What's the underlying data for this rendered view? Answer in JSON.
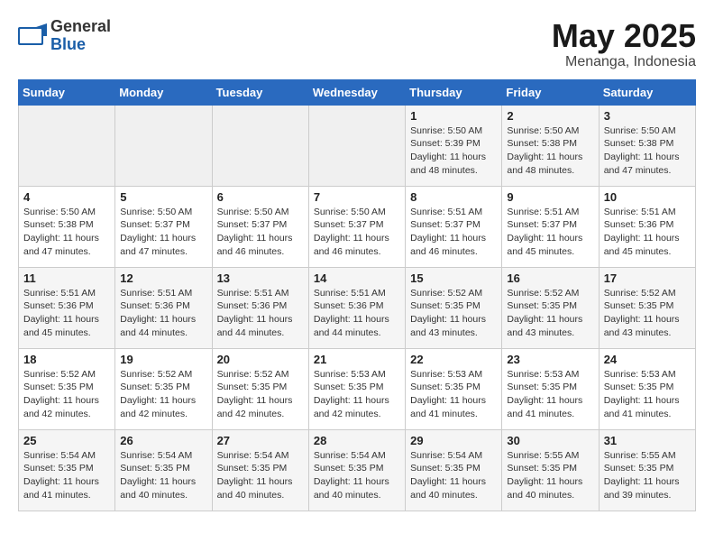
{
  "header": {
    "logo_general": "General",
    "logo_blue": "Blue",
    "month": "May 2025",
    "location": "Menanga, Indonesia"
  },
  "weekdays": [
    "Sunday",
    "Monday",
    "Tuesday",
    "Wednesday",
    "Thursday",
    "Friday",
    "Saturday"
  ],
  "weeks": [
    [
      {
        "day": "",
        "info": ""
      },
      {
        "day": "",
        "info": ""
      },
      {
        "day": "",
        "info": ""
      },
      {
        "day": "",
        "info": ""
      },
      {
        "day": "1",
        "info": "Sunrise: 5:50 AM\nSunset: 5:39 PM\nDaylight: 11 hours\nand 48 minutes."
      },
      {
        "day": "2",
        "info": "Sunrise: 5:50 AM\nSunset: 5:38 PM\nDaylight: 11 hours\nand 48 minutes."
      },
      {
        "day": "3",
        "info": "Sunrise: 5:50 AM\nSunset: 5:38 PM\nDaylight: 11 hours\nand 47 minutes."
      }
    ],
    [
      {
        "day": "4",
        "info": "Sunrise: 5:50 AM\nSunset: 5:38 PM\nDaylight: 11 hours\nand 47 minutes."
      },
      {
        "day": "5",
        "info": "Sunrise: 5:50 AM\nSunset: 5:37 PM\nDaylight: 11 hours\nand 47 minutes."
      },
      {
        "day": "6",
        "info": "Sunrise: 5:50 AM\nSunset: 5:37 PM\nDaylight: 11 hours\nand 46 minutes."
      },
      {
        "day": "7",
        "info": "Sunrise: 5:50 AM\nSunset: 5:37 PM\nDaylight: 11 hours\nand 46 minutes."
      },
      {
        "day": "8",
        "info": "Sunrise: 5:51 AM\nSunset: 5:37 PM\nDaylight: 11 hours\nand 46 minutes."
      },
      {
        "day": "9",
        "info": "Sunrise: 5:51 AM\nSunset: 5:37 PM\nDaylight: 11 hours\nand 45 minutes."
      },
      {
        "day": "10",
        "info": "Sunrise: 5:51 AM\nSunset: 5:36 PM\nDaylight: 11 hours\nand 45 minutes."
      }
    ],
    [
      {
        "day": "11",
        "info": "Sunrise: 5:51 AM\nSunset: 5:36 PM\nDaylight: 11 hours\nand 45 minutes."
      },
      {
        "day": "12",
        "info": "Sunrise: 5:51 AM\nSunset: 5:36 PM\nDaylight: 11 hours\nand 44 minutes."
      },
      {
        "day": "13",
        "info": "Sunrise: 5:51 AM\nSunset: 5:36 PM\nDaylight: 11 hours\nand 44 minutes."
      },
      {
        "day": "14",
        "info": "Sunrise: 5:51 AM\nSunset: 5:36 PM\nDaylight: 11 hours\nand 44 minutes."
      },
      {
        "day": "15",
        "info": "Sunrise: 5:52 AM\nSunset: 5:35 PM\nDaylight: 11 hours\nand 43 minutes."
      },
      {
        "day": "16",
        "info": "Sunrise: 5:52 AM\nSunset: 5:35 PM\nDaylight: 11 hours\nand 43 minutes."
      },
      {
        "day": "17",
        "info": "Sunrise: 5:52 AM\nSunset: 5:35 PM\nDaylight: 11 hours\nand 43 minutes."
      }
    ],
    [
      {
        "day": "18",
        "info": "Sunrise: 5:52 AM\nSunset: 5:35 PM\nDaylight: 11 hours\nand 42 minutes."
      },
      {
        "day": "19",
        "info": "Sunrise: 5:52 AM\nSunset: 5:35 PM\nDaylight: 11 hours\nand 42 minutes."
      },
      {
        "day": "20",
        "info": "Sunrise: 5:52 AM\nSunset: 5:35 PM\nDaylight: 11 hours\nand 42 minutes."
      },
      {
        "day": "21",
        "info": "Sunrise: 5:53 AM\nSunset: 5:35 PM\nDaylight: 11 hours\nand 42 minutes."
      },
      {
        "day": "22",
        "info": "Sunrise: 5:53 AM\nSunset: 5:35 PM\nDaylight: 11 hours\nand 41 minutes."
      },
      {
        "day": "23",
        "info": "Sunrise: 5:53 AM\nSunset: 5:35 PM\nDaylight: 11 hours\nand 41 minutes."
      },
      {
        "day": "24",
        "info": "Sunrise: 5:53 AM\nSunset: 5:35 PM\nDaylight: 11 hours\nand 41 minutes."
      }
    ],
    [
      {
        "day": "25",
        "info": "Sunrise: 5:54 AM\nSunset: 5:35 PM\nDaylight: 11 hours\nand 41 minutes."
      },
      {
        "day": "26",
        "info": "Sunrise: 5:54 AM\nSunset: 5:35 PM\nDaylight: 11 hours\nand 40 minutes."
      },
      {
        "day": "27",
        "info": "Sunrise: 5:54 AM\nSunset: 5:35 PM\nDaylight: 11 hours\nand 40 minutes."
      },
      {
        "day": "28",
        "info": "Sunrise: 5:54 AM\nSunset: 5:35 PM\nDaylight: 11 hours\nand 40 minutes."
      },
      {
        "day": "29",
        "info": "Sunrise: 5:54 AM\nSunset: 5:35 PM\nDaylight: 11 hours\nand 40 minutes."
      },
      {
        "day": "30",
        "info": "Sunrise: 5:55 AM\nSunset: 5:35 PM\nDaylight: 11 hours\nand 40 minutes."
      },
      {
        "day": "31",
        "info": "Sunrise: 5:55 AM\nSunset: 5:35 PM\nDaylight: 11 hours\nand 39 minutes."
      }
    ]
  ]
}
